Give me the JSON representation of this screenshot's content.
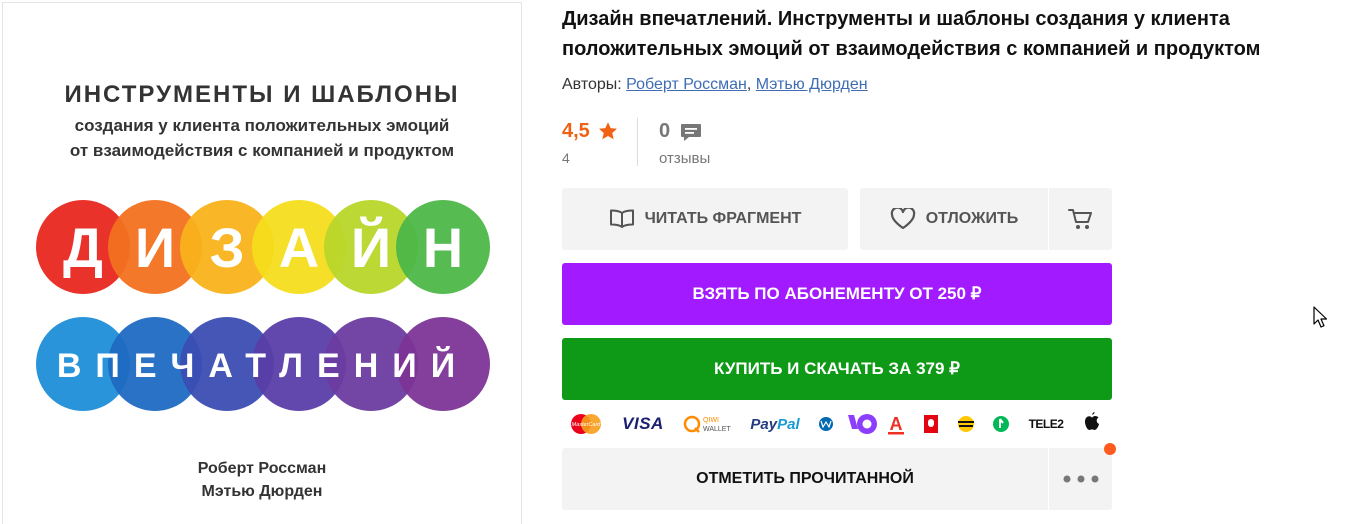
{
  "cover": {
    "heading": "ИНСТРУМЕНТЫ И ШАБЛОНЫ",
    "subtitle_line1": "создания у клиента положительных эмоций",
    "subtitle_line2": "от взаимодействия с компанией и продуктом",
    "word1_letters": [
      "Д",
      "И",
      "З",
      "А",
      "Й",
      "Н"
    ],
    "word2": "ВПЕЧАТЛЕНИЙ",
    "author1": "Роберт Россман",
    "author2": "Мэтью Дюрден",
    "circle_colors_top": [
      "#e8271f",
      "#f2711f",
      "#f9b21a",
      "#f5dd1c",
      "#b8d62a",
      "#4db748"
    ],
    "circle_colors_bottom": [
      "#1e8ed8",
      "#1f6ac2",
      "#3b4db2",
      "#5a3ea8",
      "#6b3ca0",
      "#7c3596"
    ]
  },
  "book": {
    "title": "Дизайн впечатлений. Инструменты и шаблоны создания у клиента положительных эмоций от взаимодействия с компанией и продуктом",
    "authors_label": "Авторы:",
    "author1": "Роберт Россман",
    "author_separator": ",",
    "author2": "Мэтью Дюрден"
  },
  "rating": {
    "value": "4,5",
    "count": "4",
    "reviews_count": "0",
    "reviews_label": "отзывы",
    "accent_color": "#ef6214"
  },
  "actions": {
    "read_fragment": "ЧИТАТЬ ФРАГМЕНТ",
    "wishlist": "ОТЛОЖИТЬ",
    "subscribe": "ВЗЯТЬ ПО АБОНЕМЕНТУ ОТ 250 ₽",
    "buy": "КУПИТЬ И СКАЧАТЬ ЗА 379 ₽",
    "mark_read": "ОТМЕТИТЬ ПРОЧИТАННОЙ",
    "subscribe_color": "#a21aff",
    "buy_color": "#0e9917"
  },
  "payments": {
    "mastercard_text": "MasterCard",
    "visa": "VISA",
    "qiwi_line1": "QIWI",
    "qiwi_line2": "WALLET",
    "paypal_pay": "Pay",
    "paypal_pal": "Pal",
    "alfa_letter": "А",
    "tele2": "TELE2"
  }
}
